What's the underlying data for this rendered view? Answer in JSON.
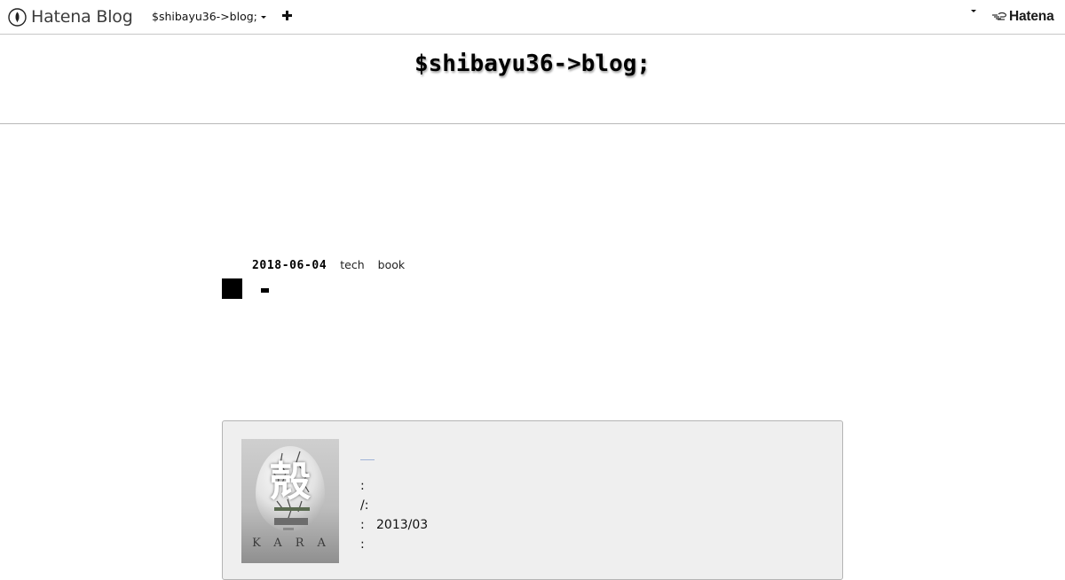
{
  "topbar": {
    "brand_label": "Hatena Blog",
    "blog_selector_label": "$shibayu36->blog;",
    "hatena_label": "Hatena",
    "icons": {
      "brand": "hatena-blog-pen-icon",
      "caret": "caret-down-icon",
      "add": "plus-icon",
      "hatena": "hatena-bird-icon"
    }
  },
  "blog": {
    "title": "$shibayu36->blog;"
  },
  "entry": {
    "date": "2018-06-04",
    "categories": [
      "tech",
      "book"
    ]
  },
  "book": {
    "cover": {
      "title_kanji": "殻",
      "bottom_text": "KARA"
    },
    "link_text": "—",
    "details": [
      {
        "key": ":",
        "value": ""
      },
      {
        "key": "/:",
        "value": ""
      },
      {
        "key": ":",
        "value": "2013/03"
      },
      {
        "key": ":",
        "value": ""
      }
    ]
  }
}
